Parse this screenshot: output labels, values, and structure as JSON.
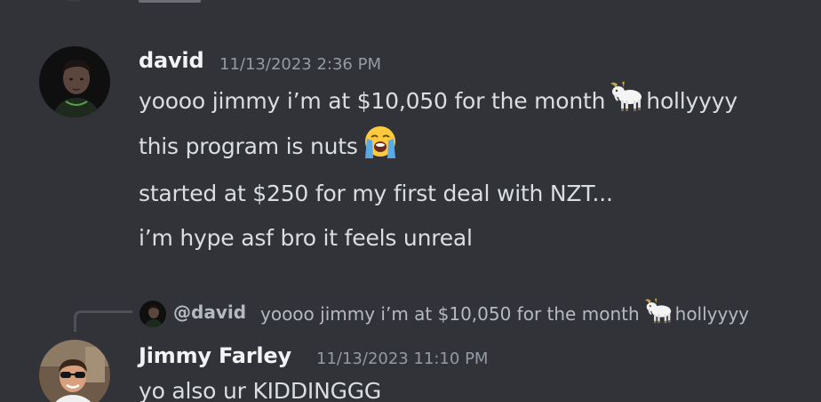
{
  "messages": [
    {
      "username": "david",
      "timestamp": "11/13/2023 2:36 PM",
      "lines": [
        {
          "before": "yoooo jimmy i’m at $10,050 for the month",
          "emoji": "goat-emoji",
          "after": "hollyyyy"
        },
        {
          "before": "this program is nuts",
          "emoji": "loudly-crying-face-emoji",
          "after": ""
        },
        {
          "before": "started at $250 for my first deal with NZT...",
          "emoji": "",
          "after": ""
        },
        {
          "before": "i’m hype asf bro it feels unreal",
          "emoji": "",
          "after": ""
        }
      ]
    },
    {
      "reply": {
        "mention": "@david",
        "preview_before": "yoooo jimmy i’m at $10,050 for the month",
        "preview_emoji": "goat-emoji",
        "preview_after": "hollyyyy"
      },
      "username": "Jimmy Farley",
      "timestamp": "11/13/2023 11:10 PM",
      "lines": [
        {
          "before": "yo also ur KIDDINGGG",
          "emoji": "",
          "after": ""
        }
      ]
    }
  ],
  "colors": {
    "background": "#313338",
    "username": "#f2f3f5",
    "message_text": "#dbdee1",
    "timestamp": "#949ba4",
    "reply_text": "#b5bac1",
    "reply_spine": "#4e5058"
  }
}
